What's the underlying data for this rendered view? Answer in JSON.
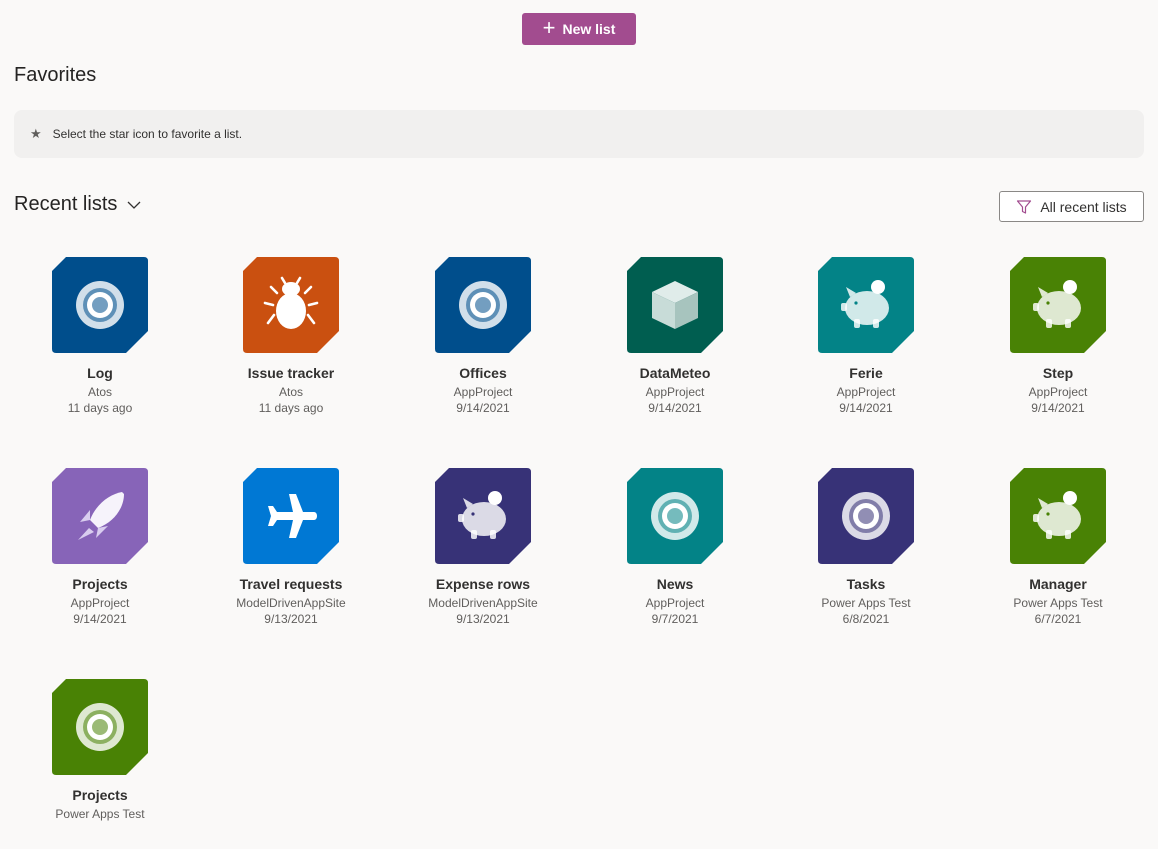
{
  "toolbar": {
    "new_list_label": "New list"
  },
  "favorites": {
    "title": "Favorites",
    "hint": "Select the star icon to favorite a list."
  },
  "recent": {
    "title": "Recent lists",
    "filter_label": "All recent lists"
  },
  "colors": {
    "accent": "#a24c8f",
    "navy": "#004e8c",
    "orange": "#ca5010",
    "dark_green": "#005e50",
    "teal": "#038387",
    "green": "#498205",
    "purple": "#8764b8",
    "blue": "#0078d4",
    "indigo": "#373277"
  },
  "lists": [
    {
      "name": "Log",
      "site": "Atos",
      "date": "11 days ago",
      "color": "#004e8c",
      "icon": "target-icon"
    },
    {
      "name": "Issue tracker",
      "site": "Atos",
      "date": "11 days ago",
      "color": "#ca5010",
      "icon": "bug-icon"
    },
    {
      "name": "Offices",
      "site": "AppProject",
      "date": "9/14/2021",
      "color": "#004e8c",
      "icon": "target-icon"
    },
    {
      "name": "DataMeteo",
      "site": "AppProject",
      "date": "9/14/2021",
      "color": "#005e50",
      "icon": "cube-icon"
    },
    {
      "name": "Ferie",
      "site": "AppProject",
      "date": "9/14/2021",
      "color": "#038387",
      "icon": "piggy-bank-icon"
    },
    {
      "name": "Step",
      "site": "AppProject",
      "date": "9/14/2021",
      "color": "#498205",
      "icon": "piggy-bank-icon"
    },
    {
      "name": "Projects",
      "site": "AppProject",
      "date": "9/14/2021",
      "color": "#8764b8",
      "icon": "rocket-icon"
    },
    {
      "name": "Travel requests",
      "site": "ModelDrivenAppSite",
      "date": "9/13/2021",
      "color": "#0078d4",
      "icon": "airplane-icon"
    },
    {
      "name": "Expense rows",
      "site": "ModelDrivenAppSite",
      "date": "9/13/2021",
      "color": "#373277",
      "icon": "piggy-bank-icon"
    },
    {
      "name": "News",
      "site": "AppProject",
      "date": "9/7/2021",
      "color": "#038387",
      "icon": "target-icon"
    },
    {
      "name": "Tasks",
      "site": "Power Apps Test",
      "date": "6/8/2021",
      "color": "#373277",
      "icon": "target-icon"
    },
    {
      "name": "Manager",
      "site": "Power Apps Test",
      "date": "6/7/2021",
      "color": "#498205",
      "icon": "piggy-bank-icon"
    },
    {
      "name": "Projects",
      "site": "Power Apps Test",
      "date": "",
      "color": "#498205",
      "icon": "target-icon"
    }
  ]
}
